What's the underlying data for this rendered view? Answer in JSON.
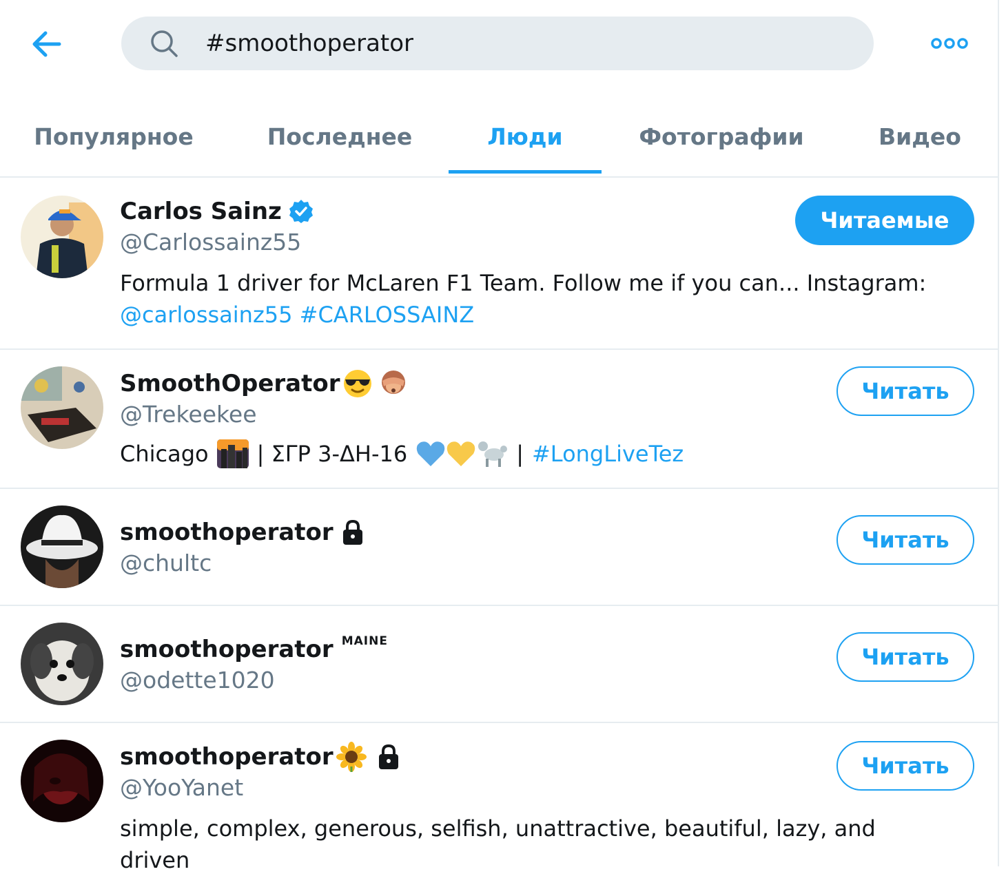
{
  "header": {
    "back_icon": "arrow-left-icon",
    "search_icon": "search-icon",
    "search_value": "#smoothoperator",
    "more_icon": "more-icon"
  },
  "tabs": [
    {
      "label": "Популярное"
    },
    {
      "label": "Последнее"
    },
    {
      "label": "Люди",
      "active": true
    },
    {
      "label": "Фотографии"
    },
    {
      "label": "Видео"
    }
  ],
  "colors": {
    "accent": "#1da1f2",
    "secondary_text": "#657786",
    "divider": "#e6ecf0",
    "search_bg": "#e6ecf0"
  },
  "users": [
    {
      "name": "Carlos Sainz",
      "verified": true,
      "handle": "@Carlossainz55",
      "bio_text": "Formula 1 driver for McLaren F1 Team. Follow me if you can... Instagram:",
      "bio_link1": "@carlossainz55",
      "bio_link2": "#CARLOSSAINZ",
      "button": "Читаемые"
    },
    {
      "name": "SmoothOperator",
      "handle": "@Trekeekee",
      "bio_text": "Chicago",
      "bio_mid": "| ΣΓΡ 3-ΔΗ-16",
      "bio_sep": "|",
      "bio_link": "#LongLiveTez",
      "button": "Читать"
    },
    {
      "name": "smoothoperator",
      "locked": true,
      "handle": "@chultc",
      "button": "Читать"
    },
    {
      "name": "smoothoperator",
      "sup": "MAINE",
      "handle": "@odette1020",
      "button": "Читать"
    },
    {
      "name": "smoothoperator",
      "locked": true,
      "handle": "@YooYanet",
      "bio_text": "simple, complex, generous, selfish, unattractive, beautiful, lazy, and driven",
      "button": "Читать"
    }
  ]
}
